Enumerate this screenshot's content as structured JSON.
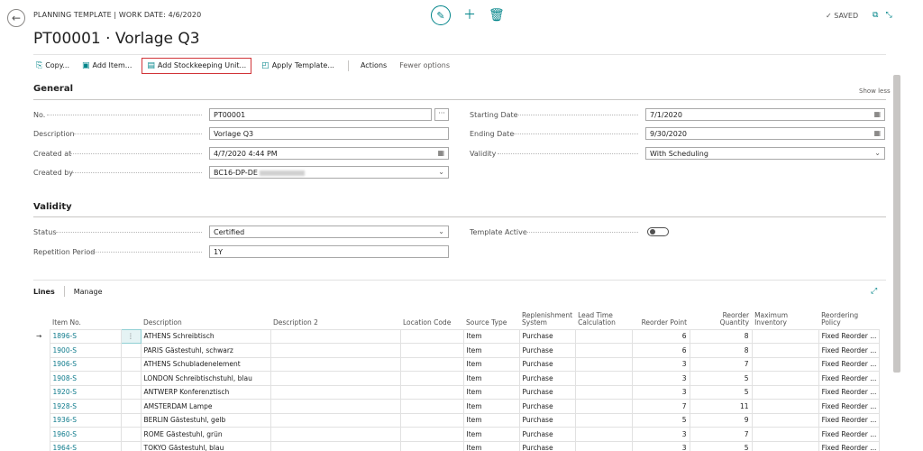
{
  "header": {
    "breadcrumb": "PLANNING TEMPLATE | WORK DATE: 4/6/2020",
    "title": "PT00001 · Vorlage Q3",
    "saved": "✓ SAVED"
  },
  "actions": {
    "copy": "Copy...",
    "add_item": "Add Item...",
    "add_sku": "Add Stockkeeping Unit...",
    "apply_template": "Apply Template...",
    "actions": "Actions",
    "fewer_options": "Fewer options"
  },
  "general": {
    "title": "General",
    "show_less": "Show less",
    "no_label": "No.",
    "no_value": "PT00001",
    "description_label": "Description",
    "description_value": "Vorlage Q3",
    "created_at_label": "Created at",
    "created_at_value": "4/7/2020 4:44 PM",
    "created_by_label": "Created by",
    "created_by_value": "BC16-DP-DE",
    "starting_date_label": "Starting Date",
    "starting_date_value": "7/1/2020",
    "ending_date_label": "Ending Date",
    "ending_date_value": "9/30/2020",
    "validity_label": "Validity",
    "validity_value": "With Scheduling"
  },
  "validity": {
    "title": "Validity",
    "status_label": "Status",
    "status_value": "Certified",
    "repetition_label": "Repetition Period",
    "repetition_value": "1Y",
    "template_active_label": "Template Active",
    "template_active": false
  },
  "lines": {
    "tab_lines": "Lines",
    "tab_manage": "Manage",
    "columns": {
      "item_no": "Item No.",
      "description": "Description",
      "description2": "Description 2",
      "location_code": "Location Code",
      "source_type": "Source Type",
      "replenishment": "Replenishment System",
      "lead_time": "Lead Time Calculation",
      "reorder_point": "Reorder Point",
      "reorder_qty": "Reorder Quantity",
      "max_inventory": "Maximum Inventory",
      "reordering_policy": "Reordering Policy"
    },
    "rows": [
      {
        "item_no": "1896-S",
        "description": "ATHENS Schreibtisch",
        "source_type": "Item",
        "replenishment": "Purchase",
        "reorder_point": "6",
        "reorder_qty": "8",
        "policy": "Fixed Reorder ..."
      },
      {
        "item_no": "1900-S",
        "description": "PARIS Gästestuhl, schwarz",
        "source_type": "Item",
        "replenishment": "Purchase",
        "reorder_point": "6",
        "reorder_qty": "8",
        "policy": "Fixed Reorder ..."
      },
      {
        "item_no": "1906-S",
        "description": "ATHENS Schubladenelement",
        "source_type": "Item",
        "replenishment": "Purchase",
        "reorder_point": "3",
        "reorder_qty": "7",
        "policy": "Fixed Reorder ..."
      },
      {
        "item_no": "1908-S",
        "description": "LONDON Schreibtischstuhl, blau",
        "source_type": "Item",
        "replenishment": "Purchase",
        "reorder_point": "3",
        "reorder_qty": "5",
        "policy": "Fixed Reorder ..."
      },
      {
        "item_no": "1920-S",
        "description": "ANTWERP Konferenztisch",
        "source_type": "Item",
        "replenishment": "Purchase",
        "reorder_point": "3",
        "reorder_qty": "5",
        "policy": "Fixed Reorder ..."
      },
      {
        "item_no": "1928-S",
        "description": "AMSTERDAM Lampe",
        "source_type": "Item",
        "replenishment": "Purchase",
        "reorder_point": "7",
        "reorder_qty": "11",
        "policy": "Fixed Reorder ..."
      },
      {
        "item_no": "1936-S",
        "description": "BERLIN Gästestuhl, gelb",
        "source_type": "Item",
        "replenishment": "Purchase",
        "reorder_point": "5",
        "reorder_qty": "9",
        "policy": "Fixed Reorder ..."
      },
      {
        "item_no": "1960-S",
        "description": "ROME Gästestuhl, grün",
        "source_type": "Item",
        "replenishment": "Purchase",
        "reorder_point": "3",
        "reorder_qty": "7",
        "policy": "Fixed Reorder ..."
      },
      {
        "item_no": "1964-S",
        "description": "TOKYO Gästestuhl, blau",
        "source_type": "Item",
        "replenishment": "Purchase",
        "reorder_point": "3",
        "reorder_qty": "5",
        "policy": "Fixed Reorder ..."
      }
    ]
  },
  "icons": {
    "back": "arrow-left-icon",
    "edit": "pencil-icon",
    "add": "plus-icon",
    "delete": "trash-icon",
    "calendar": "calendar-icon",
    "dropdown": "chevron-down-icon",
    "expand": "expand-icon"
  },
  "colors": {
    "accent": "#008489",
    "link": "#0f7b8c",
    "highlight_border": "#d13438"
  }
}
